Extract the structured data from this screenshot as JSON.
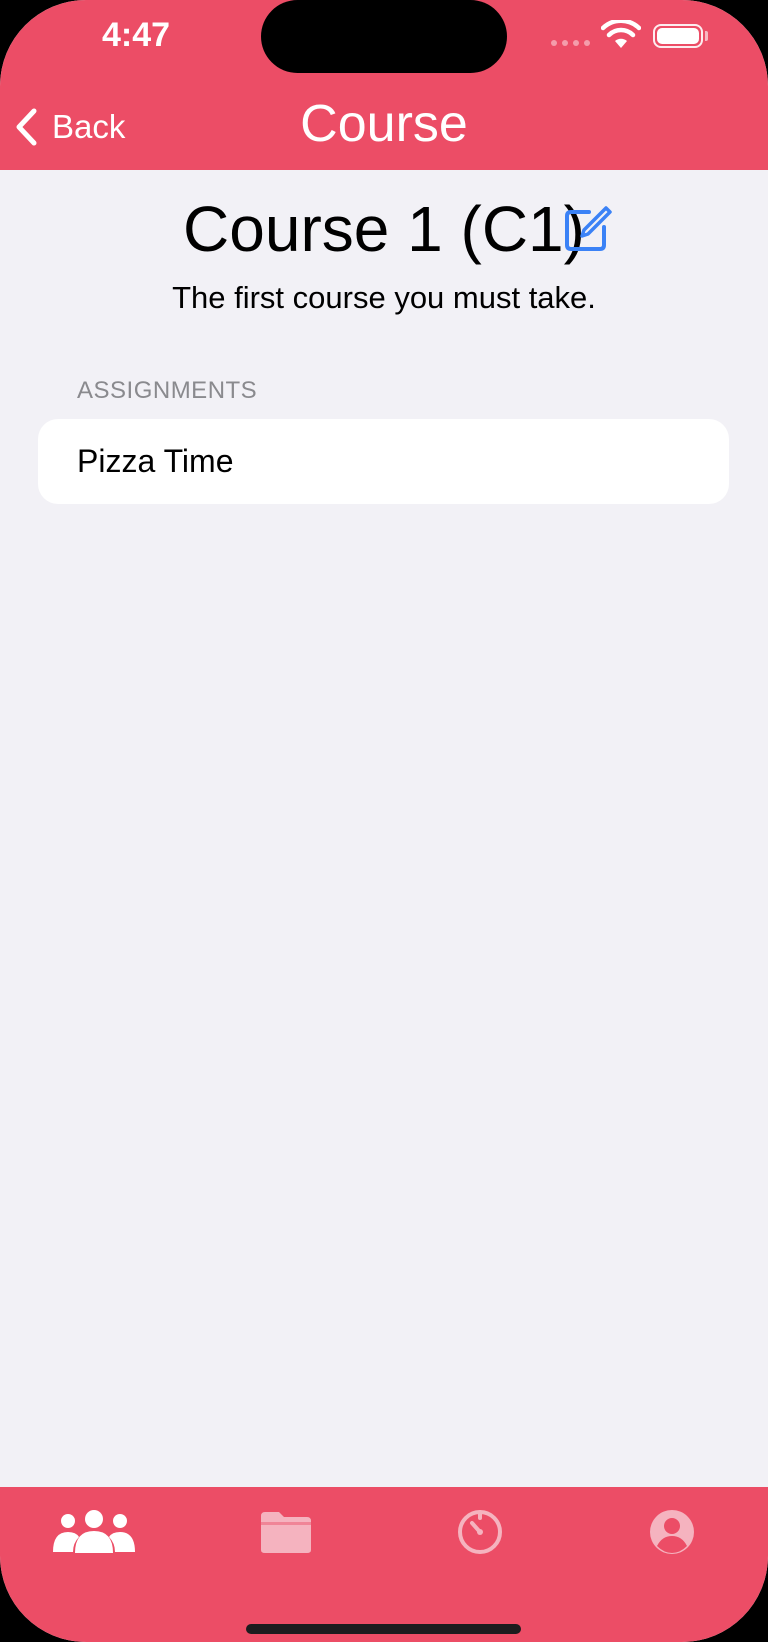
{
  "status_bar": {
    "time": "4:47"
  },
  "nav": {
    "back_label": "Back",
    "title": "Course"
  },
  "course": {
    "title": "Course 1 (C1)",
    "description": "The first course you must take."
  },
  "assignments": {
    "header": "ASSIGNMENTS",
    "items": [
      {
        "label": "Pizza Time"
      }
    ]
  },
  "tabbar": {
    "tabs": [
      {
        "icon": "people-icon",
        "selected": true
      },
      {
        "icon": "folder-icon",
        "selected": false
      },
      {
        "icon": "timer-icon",
        "selected": false
      },
      {
        "icon": "profile-icon",
        "selected": false
      }
    ]
  },
  "colors": {
    "accent": "#ec4d66",
    "background": "#f2f1f6",
    "edit_icon": "#3b82f6"
  }
}
